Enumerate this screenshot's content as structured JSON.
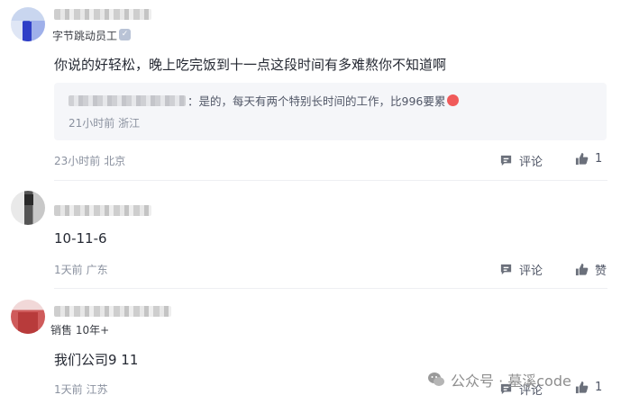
{
  "comments": [
    {
      "badge": "字节跳动员工",
      "content": "你说的好轻松，晚上吃完饭到十一点这段时间有多难熬你不知道啊",
      "quote": {
        "text": "：是的，每天有两个特别长时间的工作，比996要累",
        "time": "21小时前",
        "location": "浙江"
      },
      "time": "23小时前",
      "location": "北京",
      "comment_label": "评论",
      "like_label": "1"
    },
    {
      "content": "10-11-6",
      "time": "1天前",
      "location": "广东",
      "comment_label": "评论",
      "like_label": "赞"
    },
    {
      "badge": "销售 10年+",
      "content": "我们公司9 11",
      "time": "1天前",
      "location": "江苏",
      "comment_label": "评论",
      "like_label": "1"
    }
  ],
  "watermark": "公众号 · 墓溪code",
  "icons": {
    "comment": "comment-bubble-icon",
    "like": "thumbs-up-icon",
    "verify": "verified-check-icon",
    "wechat": "wechat-icon"
  },
  "colors": {
    "text": "#252933",
    "meta": "#8a919f",
    "quote_bg": "#f5f6f9"
  }
}
